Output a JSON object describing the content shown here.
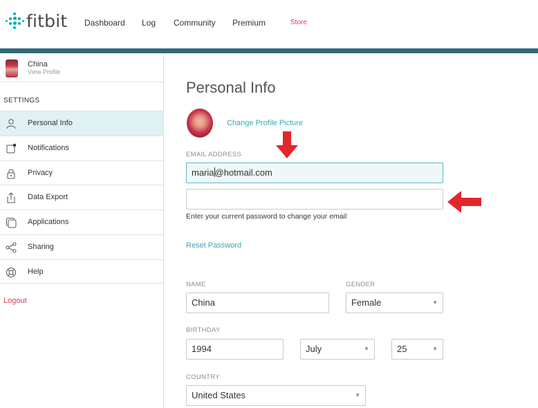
{
  "header": {
    "logo_text": "fitbit",
    "nav": [
      "Dashboard",
      "Log",
      "Community",
      "Premium"
    ],
    "store_label": "Store",
    "accent_bar_color": "#2f6a78",
    "brand_color": "#00b0b9"
  },
  "sidebar": {
    "profile": {
      "name": "China",
      "link": "View Profile"
    },
    "section_label": "SETTINGS",
    "items": [
      {
        "label": "Personal Info",
        "icon": "person-icon",
        "active": true
      },
      {
        "label": "Notifications",
        "icon": "notification-icon",
        "active": false
      },
      {
        "label": "Privacy",
        "icon": "lock-icon",
        "active": false
      },
      {
        "label": "Data Export",
        "icon": "export-icon",
        "active": false
      },
      {
        "label": "Applications",
        "icon": "applications-icon",
        "active": false
      },
      {
        "label": "Sharing",
        "icon": "share-icon",
        "active": false
      },
      {
        "label": "Help",
        "icon": "help-lifebuoy-icon",
        "active": false
      }
    ],
    "logout_label": "Logout"
  },
  "main": {
    "title": "Personal Info",
    "change_picture_label": "Change Profile Picture",
    "email": {
      "label": "EMAIL ADDRESS",
      "value_before_caret": "maria",
      "value_after_caret": "@hotmail.com"
    },
    "password": {
      "value": ""
    },
    "password_hint": "Enter your current password to change your email",
    "reset_password_label": "Reset Password",
    "name": {
      "label": "NAME",
      "value": "China"
    },
    "gender": {
      "label": "GENDER",
      "value": "Female"
    },
    "birthday": {
      "label": "BIRTHDAY",
      "year": "1994",
      "month": "July",
      "day": "25"
    },
    "country": {
      "label": "COUNTRY",
      "value": "United States"
    }
  },
  "annotations": {
    "arrow_color": "#e3262b"
  }
}
